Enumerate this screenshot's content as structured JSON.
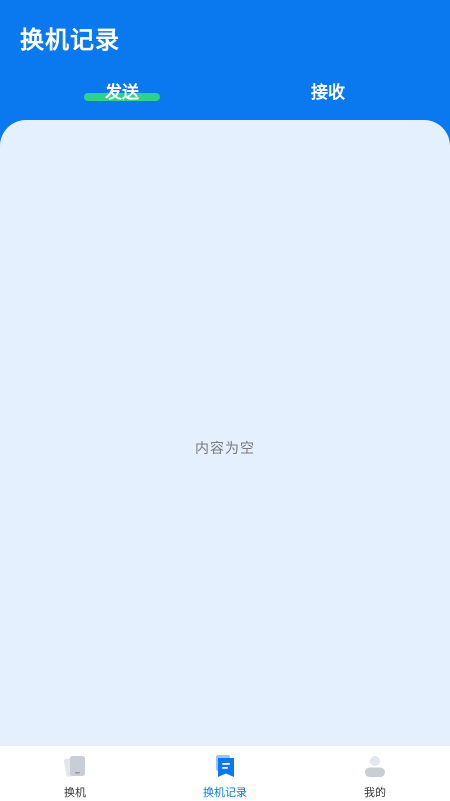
{
  "header": {
    "title": "换机记录",
    "tabs": [
      {
        "label": "发送",
        "active": true
      },
      {
        "label": "接收",
        "active": false
      }
    ]
  },
  "content": {
    "empty_text": "内容为空"
  },
  "bottom_nav": {
    "items": [
      {
        "label": "换机",
        "icon": "phone-icon",
        "active": false
      },
      {
        "label": "换机记录",
        "icon": "record-icon",
        "active": true
      },
      {
        "label": "我的",
        "icon": "user-icon",
        "active": false
      }
    ]
  },
  "colors": {
    "primary": "#0a78ef",
    "indicator": "#2fd28a",
    "content_bg": "#e4f0fd",
    "inactive_icon": "#c8cdd6"
  }
}
